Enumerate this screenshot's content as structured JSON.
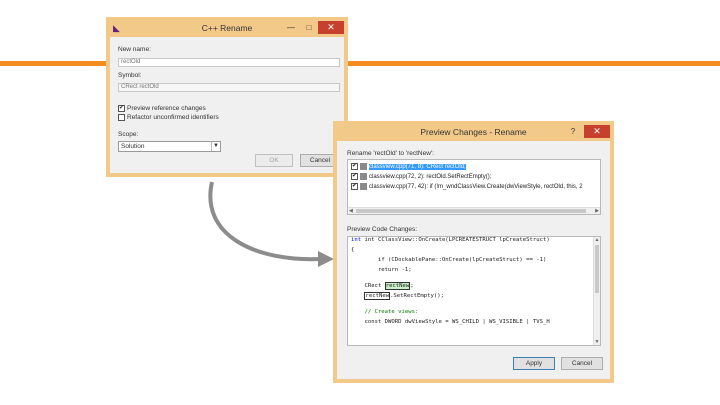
{
  "rename_dialog": {
    "title": "C++ Rename",
    "app_icon": "visual-studio-icon",
    "new_name_label": "New name:",
    "new_name_value": "rectOld",
    "symbol_label": "Symbol:",
    "symbol_value": "CRect rectOld",
    "preview_label": "Preview reference changes",
    "preview_checked": true,
    "refactor_label": "Refactor unconfirmed identifiers",
    "refactor_checked": false,
    "scope_label": "Scope:",
    "scope_value": "Solution",
    "ok_label": "OK",
    "cancel_label": "Cancel",
    "minimize_glyph": "—",
    "maximize_glyph": "□",
    "close_glyph": "✕"
  },
  "preview_dialog": {
    "title": "Preview Changes - Rename",
    "help_glyph": "?",
    "close_glyph": "✕",
    "rename_caption": "Rename 'rectOld' to 'rectNew':",
    "tree_rows": [
      {
        "text": "classview.cpp(71, 8): CRect rectOld;",
        "checked": true,
        "selected": true
      },
      {
        "text": "classview.cpp(72, 2): rectOld.SetRectEmpty();",
        "checked": true,
        "selected": false
      },
      {
        "text": "classview.cpp(77, 42): if (!m_wndClassView.Create(dwViewStyle, rectOld, this, 2",
        "checked": true,
        "selected": false
      }
    ],
    "code_caption": "Preview Code Changes:",
    "code_lines": {
      "l1a": "int CClassView::OnCreate(LPCREATESTRUCT lpCreateStruct)",
      "l2": "{",
      "l3a": "    if (CDockablePane::OnCreate(lpCreateStruct) == -1)",
      "l4": "        return -1;",
      "l5a": "    CRect ",
      "l5b": "rectNew",
      "l5c": ";",
      "l6a": "    ",
      "l6b": "rectNew",
      "l6c": ".SetRectEmpty();",
      "l7": "    // Create views:",
      "l8": "    const DWORD dwViewStyle = WS_CHILD | WS_VISIBLE | TVS_H"
    },
    "apply_label": "Apply",
    "cancel_label": "Cancel"
  },
  "colors": {
    "accent_orange": "#f28c1e",
    "window_border": "#f3c98a",
    "arrow_gray": "#8c8c8c",
    "selection_blue": "#3399ff"
  }
}
